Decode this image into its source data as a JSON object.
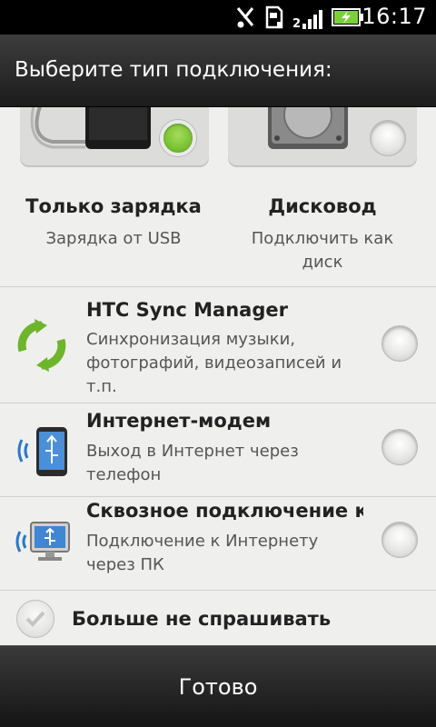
{
  "status_bar": {
    "time": "16:17",
    "icons": [
      "usb-debug-icon",
      "sd-card-icon",
      "signal-icon",
      "battery-charging-icon"
    ]
  },
  "dialog": {
    "title": "Выберите тип подключения:"
  },
  "top_options": [
    {
      "title": "Только зарядка",
      "subtitle": "Зарядка от USB",
      "selected": true
    },
    {
      "title": "Дисковод",
      "subtitle": "Подключить как диск",
      "selected": false
    }
  ],
  "list_options": [
    {
      "title": "HTC Sync Manager",
      "subtitle": "Синхронизация музыки, фотографий, видеозаписей и т.п.",
      "icon": "sync-icon",
      "selected": false
    },
    {
      "title": "Интернет-модем",
      "subtitle": "Выход в Интернет через телефон",
      "icon": "phone-usb-icon",
      "selected": false
    },
    {
      "title": "Сквозное подключение к Интернету",
      "subtitle": "Подключение к Интернету через ПК",
      "icon": "monitor-usb-icon",
      "selected": false
    }
  ],
  "dont_ask": {
    "label": "Больше не спрашивать",
    "checked": false
  },
  "footer": {
    "done_label": "Готово"
  },
  "colors": {
    "selected_green": "#79c232",
    "background": "#efefed"
  }
}
